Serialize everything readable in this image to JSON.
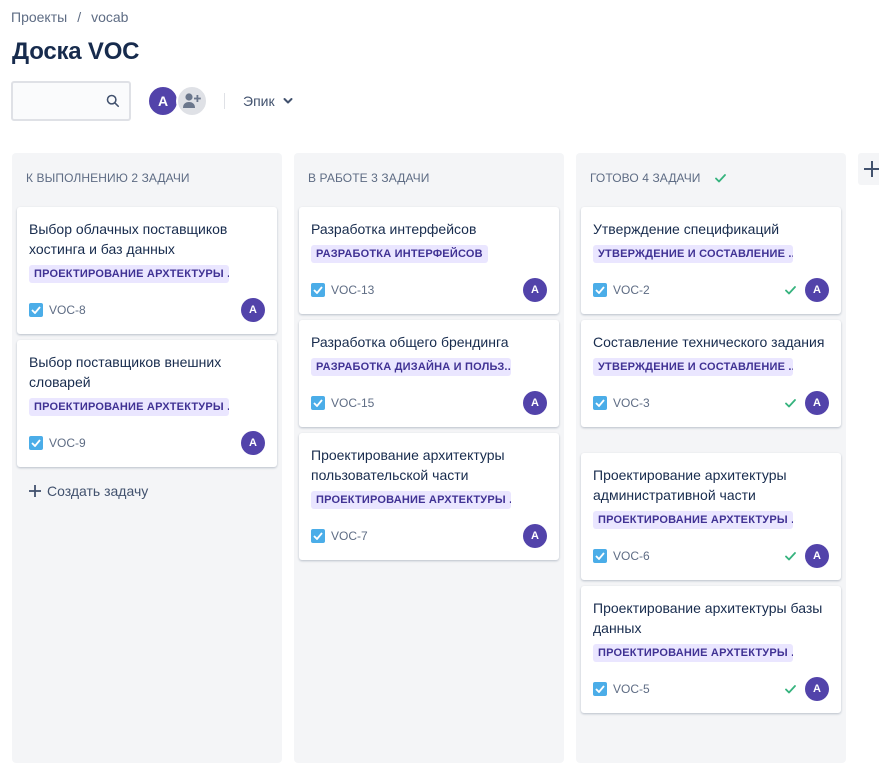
{
  "breadcrumb": {
    "projects": "Проекты",
    "separator": "/",
    "project": "vocab"
  },
  "page": {
    "title": "Доска VOC"
  },
  "toolbar": {
    "search_value": "",
    "avatar_initial": "A",
    "epic_label": "Эпик"
  },
  "colors": {
    "accent": "#5243aa",
    "epic_bg": "#eae6ff",
    "epic_text": "#403294",
    "done_check": "#36b37e",
    "checkbox": "#4bade8",
    "column_bg": "#f4f5f7"
  },
  "columns": [
    {
      "header": "К ВЫПОЛНЕНИЮ 2 ЗАДАЧИ",
      "done_marker": false,
      "cards": [
        {
          "title": "Выбор облачных поставщиков хостинга и баз данных",
          "epic": "ПРОЕКТИРОВАНИЕ АРХТЕКТУРЫ ...",
          "key": "VOC-8",
          "assignee": "A",
          "done": false
        },
        {
          "title": "Выбор поставщиков внешних словарей",
          "epic": "ПРОЕКТИРОВАНИЕ АРХТЕКТУРЫ ...",
          "key": "VOC-9",
          "assignee": "A",
          "done": false
        }
      ],
      "create_label": "Создать задачу"
    },
    {
      "header": "В РАБОТЕ 3 ЗАДАЧИ",
      "done_marker": false,
      "cards": [
        {
          "title": "Разработка интерфейсов",
          "epic": "РАЗРАБОТКА ИНТЕРФЕЙСОВ",
          "key": "VOC-13",
          "assignee": "A",
          "done": false
        },
        {
          "title": "Разработка общего брендинга",
          "epic": "РАЗРАБОТКА ДИЗАЙНА И ПОЛЬЗ...",
          "key": "VOC-15",
          "assignee": "A",
          "done": false
        },
        {
          "title": "Проектирование архитектуры пользовательской части",
          "epic": "ПРОЕКТИРОВАНИЕ АРХТЕКТУРЫ ...",
          "key": "VOC-7",
          "assignee": "A",
          "done": false
        }
      ]
    },
    {
      "header": "ГОТОВО 4 ЗАДАЧИ",
      "done_marker": true,
      "cards": [
        {
          "title": "Утверждение спецификаций",
          "epic": "УТВЕРЖДЕНИЕ И СОСТАВЛЕНИЕ ...",
          "key": "VOC-2",
          "assignee": "A",
          "done": true
        },
        {
          "title": "Составление технического задания",
          "epic": "УТВЕРЖДЕНИЕ И СОСТАВЛЕНИЕ ...",
          "key": "VOC-3",
          "assignee": "A",
          "done": true
        },
        {
          "title": "Проектирование архитектуры административной части",
          "epic": "ПРОЕКТИРОВАНИЕ АРХТЕКТУРЫ ...",
          "key": "VOC-6",
          "assignee": "A",
          "done": true
        },
        {
          "title": "Проектирование архитектуры базы данных",
          "epic": "ПРОЕКТИРОВАНИЕ АРХТЕКТУРЫ ...",
          "key": "VOC-5",
          "assignee": "A",
          "done": true
        }
      ]
    }
  ]
}
